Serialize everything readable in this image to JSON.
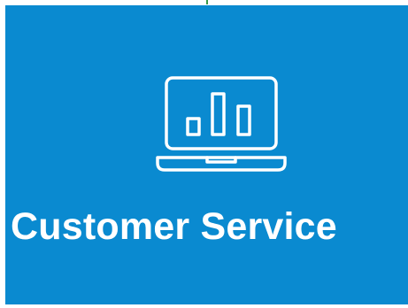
{
  "tile": {
    "label": "Customer Service",
    "icon": "laptop-bar-chart-icon"
  },
  "colors": {
    "background": "#ffffff",
    "tile": "#0a8ad0",
    "text": "#ffffff",
    "icon": "#ffffff",
    "accent_mark": "#3a9a48"
  }
}
